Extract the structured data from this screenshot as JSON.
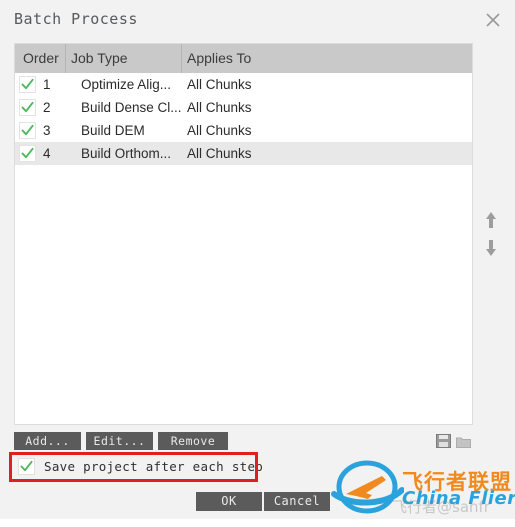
{
  "dialog": {
    "title": "Batch Process",
    "close_icon": "close-x-icon"
  },
  "table": {
    "columns": [
      "Order",
      "Job Type",
      "Applies To"
    ],
    "rows": [
      {
        "checked": true,
        "order": "1",
        "job_type": "Optimize Alig...",
        "applies_to": "All Chunks",
        "selected": false
      },
      {
        "checked": true,
        "order": "2",
        "job_type": "Build Dense Cl...",
        "applies_to": "All Chunks",
        "selected": false
      },
      {
        "checked": true,
        "order": "3",
        "job_type": "Build DEM",
        "applies_to": "All Chunks",
        "selected": false
      },
      {
        "checked": true,
        "order": "4",
        "job_type": "Build Orthom...",
        "applies_to": "All Chunks",
        "selected": true
      }
    ]
  },
  "reorder": {
    "up_icon": "arrow-up-icon",
    "down_icon": "arrow-down-icon"
  },
  "buttons": {
    "add": "Add...",
    "edit": "Edit...",
    "remove": "Remove",
    "ok": "OK",
    "cancel": "Cancel"
  },
  "side_icons": {
    "save_icon": "floppy-save-icon",
    "folder_icon": "folder-open-icon"
  },
  "options": {
    "save_project_label": "Save project after each step",
    "save_project_checked": true
  },
  "annotation": {
    "color": "#e02020"
  },
  "watermark": {
    "chinese": "飞行者联盟",
    "english": "China Flier",
    "ghost": "飞行者@sanfr",
    "orange": "#f08a1e",
    "blue": "#2aa3dd"
  }
}
